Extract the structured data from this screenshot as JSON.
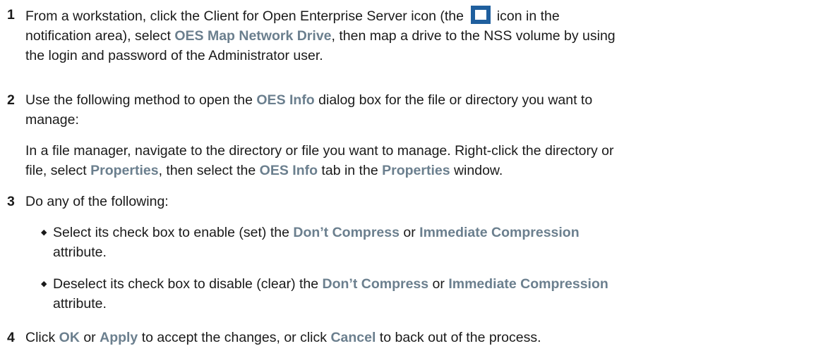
{
  "steps": [
    {
      "number": "1",
      "line1_before_icon": "From a workstation, click the Client for Open Enterprise Server icon (the ",
      "line1_after_icon": " icon in the",
      "line2_before": "notification area), select ",
      "line2_ui": "OES Map Network Drive",
      "line2_after": ", then map a drive to the NSS volume by using",
      "line3": "the login and password of the Administrator user.",
      "icon": "oes-client-icon"
    },
    {
      "number": "2",
      "line1_before": "Use the following method to open the ",
      "line1_ui": "OES Info",
      "line1_after": " dialog box for the file or directory you want to",
      "line2": "manage:",
      "para_line1": "In a file manager, navigate to the directory or file you want to manage. Right-click the directory or",
      "para_line2_a": "file, select ",
      "para_line2_ui1": "Properties",
      "para_line2_b": ", then select the ",
      "para_line2_ui2": "OES Info",
      "para_line2_c": " tab in the ",
      "para_line2_ui3": "Properties",
      "para_line2_d": " window."
    },
    {
      "number": "3",
      "text": "Do any of the following:",
      "bullets": [
        {
          "a": "Select its check box to enable (set) the ",
          "ui1": "Don’t Compress",
          "b": " or ",
          "ui2": "Immediate Compression",
          "c": "attribute."
        },
        {
          "a": "Deselect its check box to disable (clear) the ",
          "ui1": "Don’t Compress",
          "b": " or ",
          "ui2": "Immediate Compression",
          "c": "attribute."
        }
      ]
    },
    {
      "number": "4",
      "a": "Click ",
      "ui1": "OK",
      "b": " or ",
      "ui2": "Apply",
      "c": " to accept the changes, or click ",
      "ui3": "Cancel",
      "d": " to back out of the process."
    }
  ],
  "colors": {
    "text": "#1a1a1a",
    "ui_term": "#6b7f8e",
    "icon_blue": "#1f5f9e"
  },
  "bullet_glyph": "◆"
}
